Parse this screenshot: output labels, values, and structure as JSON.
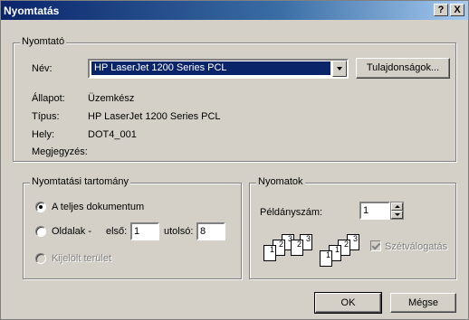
{
  "window": {
    "title": "Nyomtatás",
    "help_label": "?",
    "close_label": "X"
  },
  "printer": {
    "group_label": "Nyomtató",
    "name_label": "Név:",
    "name_value": "HP LaserJet 1200 Series PCL",
    "properties_label": "Tulajdonságok...",
    "status_label": "Állapot:",
    "status_value": "Üzemkész",
    "type_label": "Típus:",
    "type_value": "HP LaserJet 1200 Series PCL",
    "where_label": "Hely:",
    "where_value": "DOT4_001",
    "comment_label": "Megjegyzés:"
  },
  "range": {
    "group_label": "Nyomtatási tartomány",
    "all_label": "A teljes dokumentum",
    "pages_label": "Oldalak -",
    "from_label": "első:",
    "from_value": "1",
    "to_label": "utolsó:",
    "to_value": "8",
    "selection_label": "Kijelölt terület",
    "selected": "all"
  },
  "copies": {
    "group_label": "Nyomatok",
    "count_label": "Példányszám:",
    "count_value": "1",
    "collate_label": "Szétválogatás",
    "collate_checked": true,
    "collate_disabled": true,
    "pages_set1": [
      "1",
      "2",
      "3"
    ],
    "pages_set2": [
      "1",
      "2",
      "3"
    ]
  },
  "buttons": {
    "ok_label": "OK",
    "cancel_label": "Mégse"
  }
}
